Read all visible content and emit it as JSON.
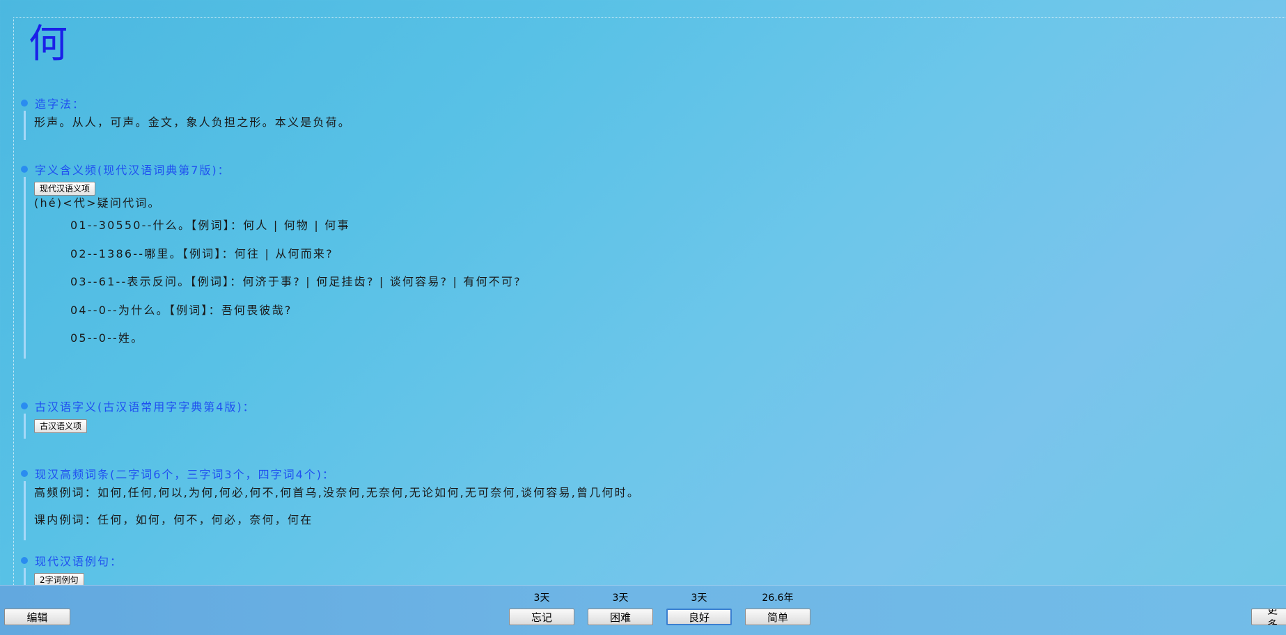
{
  "card": {
    "character": "何",
    "sections": {
      "formation": {
        "title": "造字法：",
        "text": "形声。从人，可声。金文，象人负担之形。本义是负荷。"
      },
      "modern_meaning": {
        "title": "字义含义频(现代汉语词典第7版)：",
        "button": "现代汉语义项",
        "pos_line": "(hé)<代>疑问代词。",
        "items": [
          "01--30550--什么。【例词】：何人 | 何物 | 何事",
          "02--1386--哪里。【例词】：何往 | 从何而来?",
          "03--61--表示反问。【例词】：何济于事? | 何足挂齿? | 谈何容易? | 有何不可?",
          "04--0--为什么。【例词】：吾何畏彼哉?",
          "05--0--姓。"
        ]
      },
      "ancient_meaning": {
        "title": "古汉语字义(古汉语常用字字典第4版)：",
        "button": "古汉语义项"
      },
      "high_freq": {
        "title": "现汉高频词条(二字词6个，三字词3个，四字词4个)：",
        "line1": "高频例词：如何,任何,何以,为何,何必,何不,何首乌,没奈何,无奈何,无论如何,无可奈何,谈何容易,曾几何时。",
        "line2": "课内例词：任何，如何，何不，何必，奈何，何在"
      },
      "modern_examples": {
        "title": "现代汉语例句：",
        "button": "2字词例句"
      }
    }
  },
  "bottom_bar": {
    "edit_label": "编辑",
    "more_label": "更多",
    "answers": [
      {
        "interval": "3天",
        "label": "忘记"
      },
      {
        "interval": "3天",
        "label": "困难"
      },
      {
        "interval": "3天",
        "label": "良好"
      },
      {
        "interval": "26.6年",
        "label": "简单"
      }
    ]
  },
  "colors": {
    "character": "#1a20e8",
    "section_title": "#1f4ff0",
    "bullet": "#2a8cf0"
  }
}
